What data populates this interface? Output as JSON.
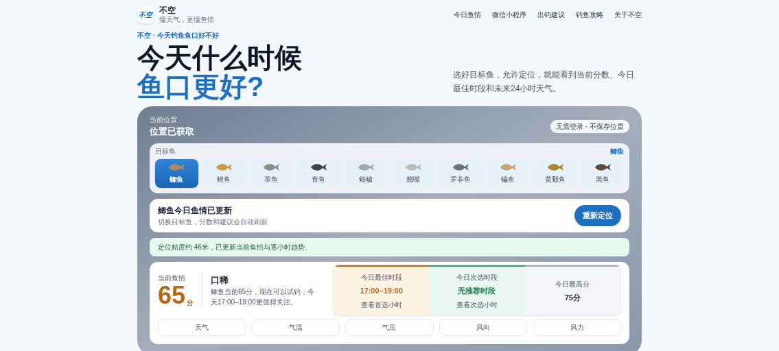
{
  "brand": {
    "logo": "不空",
    "name": "不空",
    "tagline": "懂天气，更懂鱼情"
  },
  "nav": [
    {
      "label": "今日鱼情"
    },
    {
      "label": "微信小程序"
    },
    {
      "label": "出钓建议"
    },
    {
      "label": "钓鱼攻略"
    },
    {
      "label": "关于不空"
    }
  ],
  "hero": {
    "eyebrow": "不空 · 今天钓鱼鱼口好不好",
    "title_line1": "今天什么时候",
    "title_line2": "鱼口更好?",
    "description": "选好目标鱼，允许定位，就能看到当前分数、今日最佳时段和未来24小时天气。"
  },
  "location": {
    "label": "当前位置",
    "status": "位置已获取",
    "privacy_badge": "无需登录 · 不保存位置"
  },
  "target_fish": {
    "label": "目标鱼",
    "current": "鲫鱼",
    "fish": [
      {
        "name": "鲫鱼",
        "selected": true
      },
      {
        "name": "鲤鱼",
        "selected": false
      },
      {
        "name": "草鱼",
        "selected": false
      },
      {
        "name": "青鱼",
        "selected": false
      },
      {
        "name": "鲢鳙",
        "selected": false
      },
      {
        "name": "翘嘴",
        "selected": false
      },
      {
        "name": "罗非鱼",
        "selected": false
      },
      {
        "name": "鳊鱼",
        "selected": false
      },
      {
        "name": "黄颡鱼",
        "selected": false
      },
      {
        "name": "黑鱼",
        "selected": false
      }
    ]
  },
  "update": {
    "title": "鲫鱼今日鱼情已更新",
    "subtitle": "切换目标鱼，分数和建议会自动刷新",
    "button": "重新定位"
  },
  "notice": "定位精度约 46米，已更新当前鱼情与逐小时趋势。",
  "current": {
    "label": "当前鱼情",
    "score": "65",
    "unit": "分",
    "verdict": "口稀",
    "summary": "鲫鱼当前65分，现在可以试钓；今天17:00–19:00更值得关注。"
  },
  "slots": [
    {
      "kind": "best",
      "label": "今日最佳时段",
      "value": "17:00–19:00",
      "link": "查看首选小时"
    },
    {
      "kind": "second",
      "label": "今日次选时段",
      "value": "无推荐时段",
      "link": "查看次选小时"
    },
    {
      "kind": "peak",
      "label": "今日最高分",
      "value": "75分"
    }
  ],
  "weather_columns": [
    {
      "label": "天气"
    },
    {
      "label": "气温"
    },
    {
      "label": "气压"
    },
    {
      "label": "风向"
    },
    {
      "label": "风力"
    }
  ]
}
